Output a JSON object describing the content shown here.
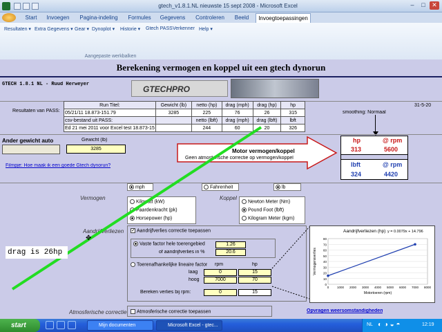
{
  "window": {
    "title": "gtech_v1.8.1.NL nieuwste 15 sept 2008 - Microsoft Excel",
    "min": "‒",
    "max": "□",
    "close": "✕"
  },
  "tabs": [
    "Start",
    "Invoegen",
    "Pagina-indeling",
    "Formules",
    "Gegevens",
    "Controleren",
    "Beeld",
    "Invoegtoepassingen"
  ],
  "menus": [
    "Resultaten ▾",
    "Extra Gegevens ▾",
    "Gear ▾",
    "Dynoplot ▾",
    "Historie ▾",
    "Gtech PASS",
    "Verkenner",
    "Help ▾"
  ],
  "ribbon_group": "Aangepaste werkbalken",
  "sheet": {
    "heading": "Berekening vermogen en koppel uit een gtech dynorun",
    "version": "GTECH 1.8.1 NL - Ruud Herweyer",
    "logo_text": "GTECHPRO",
    "date_right": "31-5-20",
    "smoothing": "smoothing: Normaal",
    "pass_label": "Resultaten van PASS:",
    "table": {
      "headers": [
        "Run Titel:",
        "Gewicht (lb)",
        "netto (hp)",
        "drag (mph)",
        "drag (hp)",
        "hp"
      ],
      "row1": [
        "05/21/11 18.873-151.79",
        "3285",
        "225",
        "76",
        "26",
        "315"
      ],
      "row2": [
        "csv-bestand uit PASS:",
        "",
        "netto (lbft)",
        "drag (mph)",
        "drag (lbft)",
        "lbft"
      ],
      "row3": [
        "Ed 21 mei 2011 voor Excel test 18.873-15",
        "",
        "244",
        "60",
        "20",
        "326"
      ]
    },
    "ander_gewicht": "Ander gewicht auto",
    "herbereken": "Herberekenen",
    "gewicht_label": "Gewicht (lb)",
    "gewicht_value": "3285",
    "filmpje": "Filmpje: Hoe maak ik een goede Gtech dynorun?",
    "arrow_title": "Motor vermogen/koppel",
    "arrow_sub": "Geen atmosferische correctie op vermogen/koppel",
    "results": {
      "hp_label": "hp",
      "rpm_label": "@ rpm",
      "hp": "313",
      "hp_rpm": "5600",
      "lbft_label": "lbft",
      "lbft": "324",
      "lbft_rpm": "4420"
    },
    "units": {
      "mph": "mph",
      "fahrenheit": "Fahrenheit",
      "lb": "lb"
    },
    "vermogen_label": "Vermogen",
    "vermogen_opts": [
      "Kilowatt (kW)",
      "Paardenkracht (pk)",
      "Horsepower (hp)"
    ],
    "koppel_label": "Koppel",
    "koppel_opts": [
      "Newton Meter (Nm)",
      "Pound Foot (lbft)",
      "Kilogram Meter (kgm)"
    ],
    "aandrijf_label": "Aandrijfverliezen",
    "aandrijf_chk": "Aandrijfverlies correctie toepassen",
    "vaste_factor": "Vaste factor hele toerengebied",
    "vaste_value": "1.26",
    "of_aandrijf": "of aandrijfverlies in %",
    "of_value": "20.6",
    "toeren_label": "Toerenafhankelijke lineaire factor",
    "rpm_col": "rpm",
    "hp_col": "hp",
    "laag": "laag",
    "laag_rpm": "0",
    "laag_hp": "15",
    "hoog": "hoog",
    "hoog_rpm": "7000",
    "hoog_hp": "70",
    "bereken_label": "Bereken verlies bij rpm:",
    "bereken_rpm": "0",
    "bereken_hp": "15",
    "atmos_label": "Atmosferische correctie",
    "atmos_chk": "Atmosferische correctie toepassen",
    "opvragen": "Opvragen weersomstandigheden",
    "annotation": "drag is 26hp"
  },
  "chart_data": {
    "type": "line",
    "title": "Aandrijfverliezen (hp)",
    "equation": "y = 0.0079x + 14.796",
    "xlabel": "Motortoeren (rpm)",
    "ylabel": "Vermogensverlies",
    "x": [
      0,
      7000
    ],
    "y": [
      15,
      70
    ],
    "xticks": [
      "0",
      "1000",
      "2000",
      "3000",
      "4000",
      "5000",
      "6000",
      "7000",
      "8000"
    ],
    "yticks": [
      "0",
      "10",
      "20",
      "30",
      "40",
      "50",
      "60",
      "70",
      "80"
    ],
    "xlim": [
      0,
      8000
    ],
    "ylim": [
      0,
      80
    ],
    "color": "#1f3fb0"
  },
  "taskbar": {
    "start": "start",
    "items": [
      "Mijn documenten",
      "Microsoft Excel - gtec..."
    ],
    "language": "NL",
    "clock": "12:19"
  }
}
